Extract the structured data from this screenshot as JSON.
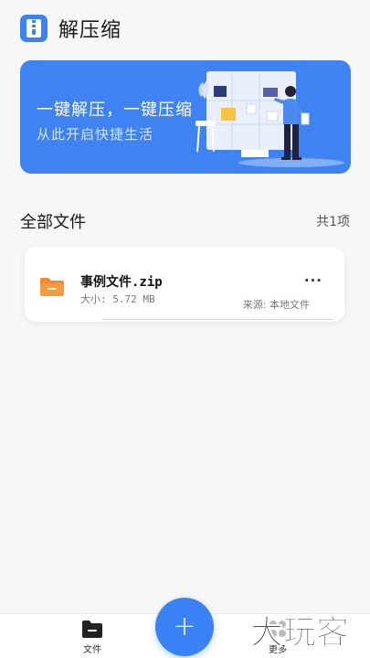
{
  "app": {
    "title": "解压缩",
    "logo_icon": "zip-archive-icon",
    "accent_color": "#3b82f6"
  },
  "banner": {
    "title": "一键解压，一键压缩",
    "subtitle": "从此开启快捷生活",
    "background": "#3f83f2"
  },
  "section": {
    "title": "全部文件",
    "count": "共1项"
  },
  "files": [
    {
      "name": "事例文件.zip",
      "size": "大小: 5.72 MB",
      "source": "来源: 本地文件",
      "icon": "folder-icon",
      "icon_color": "#f28a2e",
      "more": "···"
    }
  ],
  "fab": {
    "label": "+"
  },
  "nav": {
    "files_label": "文件",
    "more_label": "更多"
  },
  "watermark": {
    "text": "大玩客"
  }
}
